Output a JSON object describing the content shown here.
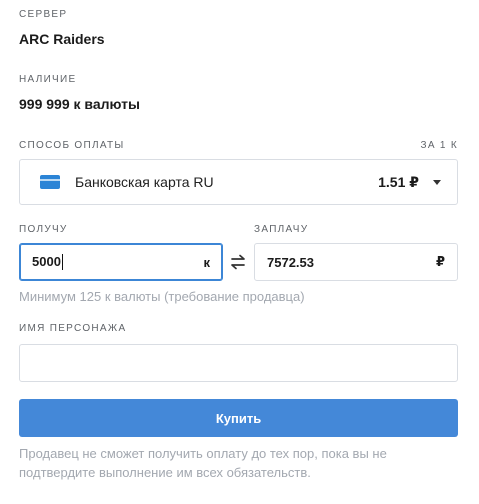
{
  "server": {
    "label": "СЕРВЕР",
    "value": "ARC Raiders"
  },
  "stock": {
    "label": "НАЛИЧИЕ",
    "value": "999 999 к валюты"
  },
  "payment": {
    "label": "СПОСОБ ОПЛАТЫ",
    "per_unit_label": "ЗА 1 К",
    "selected_method": "Банковская карта RU",
    "price": "1.51 ₽",
    "icons": {
      "method": "credit-card-icon",
      "expand": "chevron-down-icon"
    }
  },
  "receive": {
    "label": "ПОЛУЧУ",
    "value": "5000",
    "unit": "к"
  },
  "swap_icon": "swap-arrows-icon",
  "pay": {
    "label": "ЗАПЛАЧУ",
    "value": "7572.53",
    "unit": "₽"
  },
  "minimum_hint": "Минимум 125 к валюты (требование продавца)",
  "character": {
    "label": "ИМЯ ПЕРСОНАЖА",
    "value": "",
    "placeholder": ""
  },
  "buy_button": {
    "label": "Купить"
  },
  "disclaimer": {
    "line1": "Продавец не сможет получить оплату до тех пор, пока вы не",
    "line2": "подтвердите выполнение им всех обязательств."
  },
  "colors": {
    "accent": "#4488d8",
    "focus_border": "#3c86d6",
    "card_icon": "#2b84d6",
    "hint_text": "#a3a8b0"
  }
}
